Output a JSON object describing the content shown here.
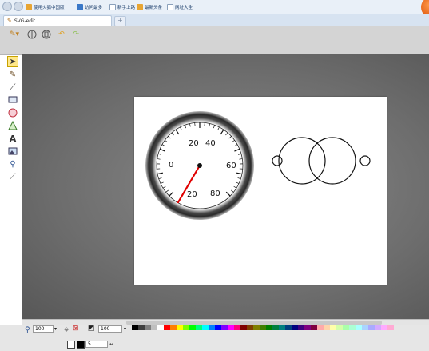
{
  "bookmarks": [
    {
      "label": "使用火狐中国版",
      "color": "#e8a533"
    },
    {
      "label": "访问最多",
      "color": "#3a78c8"
    },
    {
      "label": "新手上路",
      "color": "#ffffff"
    },
    {
      "label": "最新头条",
      "color": "#e8a533"
    },
    {
      "label": "网址大全",
      "color": "#ffffff"
    }
  ],
  "tab": {
    "title": "SVG-edit",
    "new_tab": "+"
  },
  "gauge": {
    "tick_labels": [
      "0",
      "20",
      "40",
      "60",
      "80",
      "20"
    ],
    "needle_value": 20
  },
  "zoom": {
    "value": "100"
  },
  "opacity": {
    "value": "100"
  },
  "stroke_width": {
    "value": "5"
  },
  "colors": {
    "needle": "#e00000",
    "selected_tool": "#ffe88a",
    "browser_ball": "#e86a1a"
  }
}
